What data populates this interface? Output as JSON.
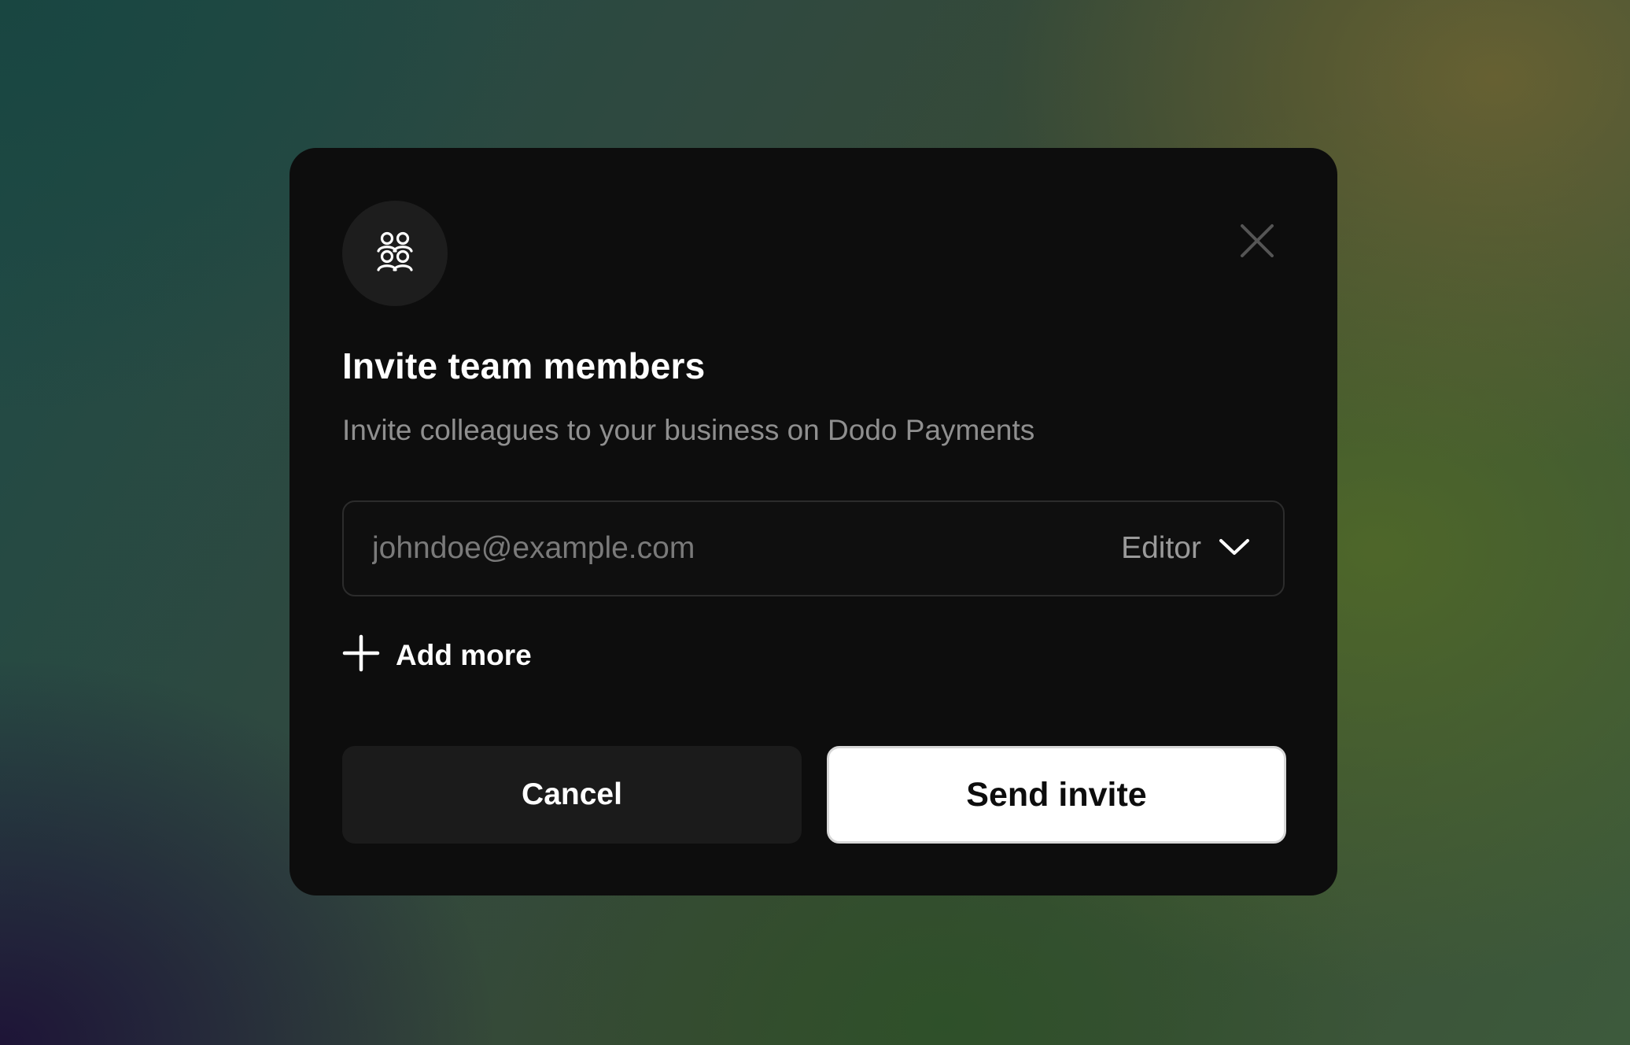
{
  "dialog": {
    "title": "Invite team members",
    "subtitle": "Invite colleagues to your business on Dodo Payments",
    "icon": "team-users-icon",
    "close_icon": "close-icon"
  },
  "invite": {
    "email_value": "",
    "email_placeholder": "johndoe@example.com",
    "role_selected": "Editor",
    "role_icon": "chevron-down-icon"
  },
  "add_more": {
    "label": "Add more",
    "icon": "plus-icon"
  },
  "actions": {
    "cancel_label": "Cancel",
    "send_label": "Send invite"
  },
  "colors": {
    "modal_bg": "#0d0d0d",
    "primary_button_bg": "#ffffff",
    "secondary_button_bg": "#1b1b1b",
    "muted_text": "#8f8f8f"
  }
}
